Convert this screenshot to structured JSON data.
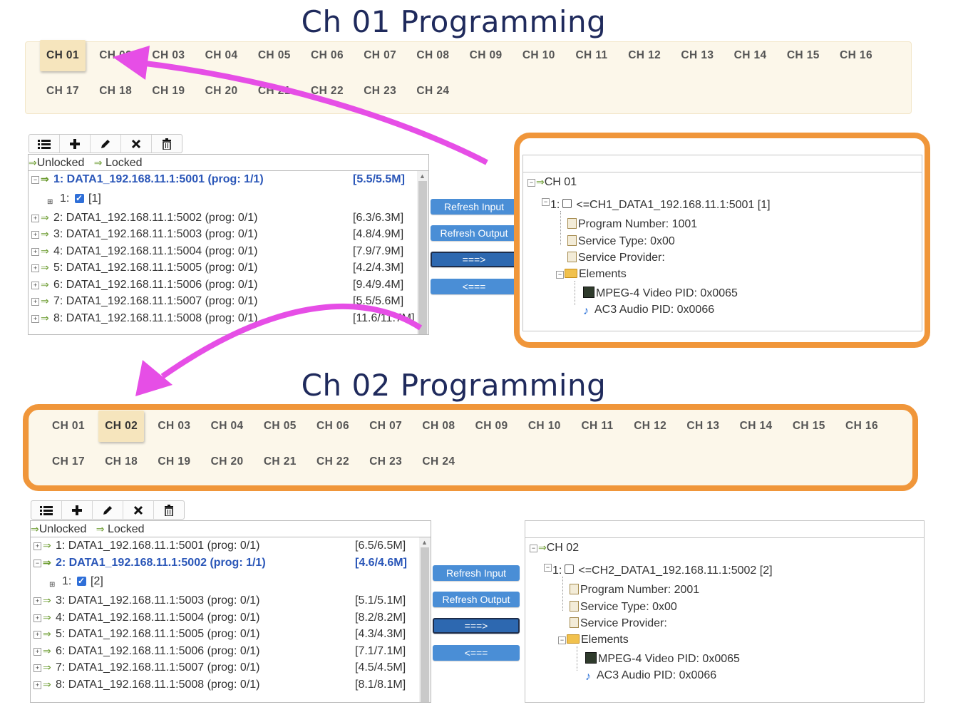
{
  "headings": {
    "ch01": "Ch 01 Programming",
    "ch02": "Ch 02 Programming"
  },
  "tabs": [
    "CH 01",
    "CH 02",
    "CH 03",
    "CH 04",
    "CH 05",
    "CH 06",
    "CH 07",
    "CH 08",
    "CH 09",
    "CH 10",
    "CH 11",
    "CH 12",
    "CH 13",
    "CH 14",
    "CH 15",
    "CH 16",
    "CH 17",
    "CH 18",
    "CH 19",
    "CH 20",
    "CH 21",
    "CH 22",
    "CH 23",
    "CH 24"
  ],
  "toolbar": {
    "icons": [
      "list-icon",
      "plus-icon",
      "pencil-icon",
      "close-icon",
      "trash-icon"
    ]
  },
  "legend": {
    "unlocked": "Unlocked",
    "locked": "Locked"
  },
  "buttons": {
    "refresh_input": "Refresh Input",
    "refresh_output": "Refresh Output",
    "add": "===>",
    "remove": "<==="
  },
  "section1": {
    "active_tab": "CH 01",
    "inputs": [
      {
        "label": "1: DATA1_192.168.11.1:5001 (prog: 1/1)",
        "rate": "[5.5/5.5M]",
        "selected": true
      },
      {
        "label": "2: DATA1_192.168.11.1:5002 (prog: 0/1)",
        "rate": "[6.3/6.3M]"
      },
      {
        "label": "3: DATA1_192.168.11.1:5003 (prog: 0/1)",
        "rate": "[4.8/4.9M]"
      },
      {
        "label": "4: DATA1_192.168.11.1:5004 (prog: 0/1)",
        "rate": "[7.9/7.9M]"
      },
      {
        "label": "5: DATA1_192.168.11.1:5005 (prog: 0/1)",
        "rate": "[4.2/4.3M]"
      },
      {
        "label": "6: DATA1_192.168.11.1:5006 (prog: 0/1)",
        "rate": "[9.4/9.4M]"
      },
      {
        "label": "7: DATA1_192.168.11.1:5007 (prog: 0/1)",
        "rate": "[5.5/5.6M]"
      },
      {
        "label": "8: DATA1_192.168.11.1:5008 (prog: 0/1)",
        "rate": "[11.6/11.7M]"
      }
    ],
    "sub": {
      "index": "1:",
      "value": "[1]"
    },
    "output": {
      "channel": "CH 01",
      "program": "<=CH1_DATA1_192.168.11.1:5001 [1]",
      "program_index": "1:",
      "program_number": "Program Number: 1001",
      "service_type": "Service Type: 0x00",
      "service_provider": "Service Provider:",
      "elements": "Elements",
      "video": "MPEG-4 Video PID: 0x0065",
      "audio": "AC3 Audio PID: 0x0066"
    }
  },
  "section2": {
    "active_tab": "CH 02",
    "inputs": [
      {
        "label": "1: DATA1_192.168.11.1:5001 (prog: 0/1)",
        "rate": "[6.5/6.5M]"
      },
      {
        "label": "2: DATA1_192.168.11.1:5002 (prog: 1/1)",
        "rate": "[4.6/4.6M]",
        "selected": true
      },
      {
        "label": "3: DATA1_192.168.11.1:5003 (prog: 0/1)",
        "rate": "[5.1/5.1M]"
      },
      {
        "label": "4: DATA1_192.168.11.1:5004 (prog: 0/1)",
        "rate": "[8.2/8.2M]"
      },
      {
        "label": "5: DATA1_192.168.11.1:5005 (prog: 0/1)",
        "rate": "[4.3/4.3M]"
      },
      {
        "label": "6: DATA1_192.168.11.1:5006 (prog: 0/1)",
        "rate": "[7.1/7.1M]"
      },
      {
        "label": "7: DATA1_192.168.11.1:5007 (prog: 0/1)",
        "rate": "[4.5/4.5M]"
      },
      {
        "label": "8: DATA1_192.168.11.1:5008 (prog: 0/1)",
        "rate": "[8.1/8.1M]"
      }
    ],
    "sub": {
      "index": "1:",
      "value": "[2]"
    },
    "output": {
      "channel": "CH 02",
      "program": "<=CH2_DATA1_192.168.11.1:5002 [2]",
      "program_index": "1:",
      "program_number": "Program Number: 2001",
      "service_type": "Service Type: 0x00",
      "service_provider": "Service Provider:",
      "elements": "Elements",
      "video": "MPEG-4 Video PID: 0x0065",
      "audio": "AC3 Audio PID: 0x0066"
    }
  },
  "colors": {
    "highlight": "#f0963a",
    "arrow": "#e64ee6",
    "tab_bg": "#fcf7ea",
    "tab_active": "#f6e5bd",
    "button": "#4a8ed6",
    "selected_text": "#2a56b8",
    "heading": "#1f2a5c"
  }
}
